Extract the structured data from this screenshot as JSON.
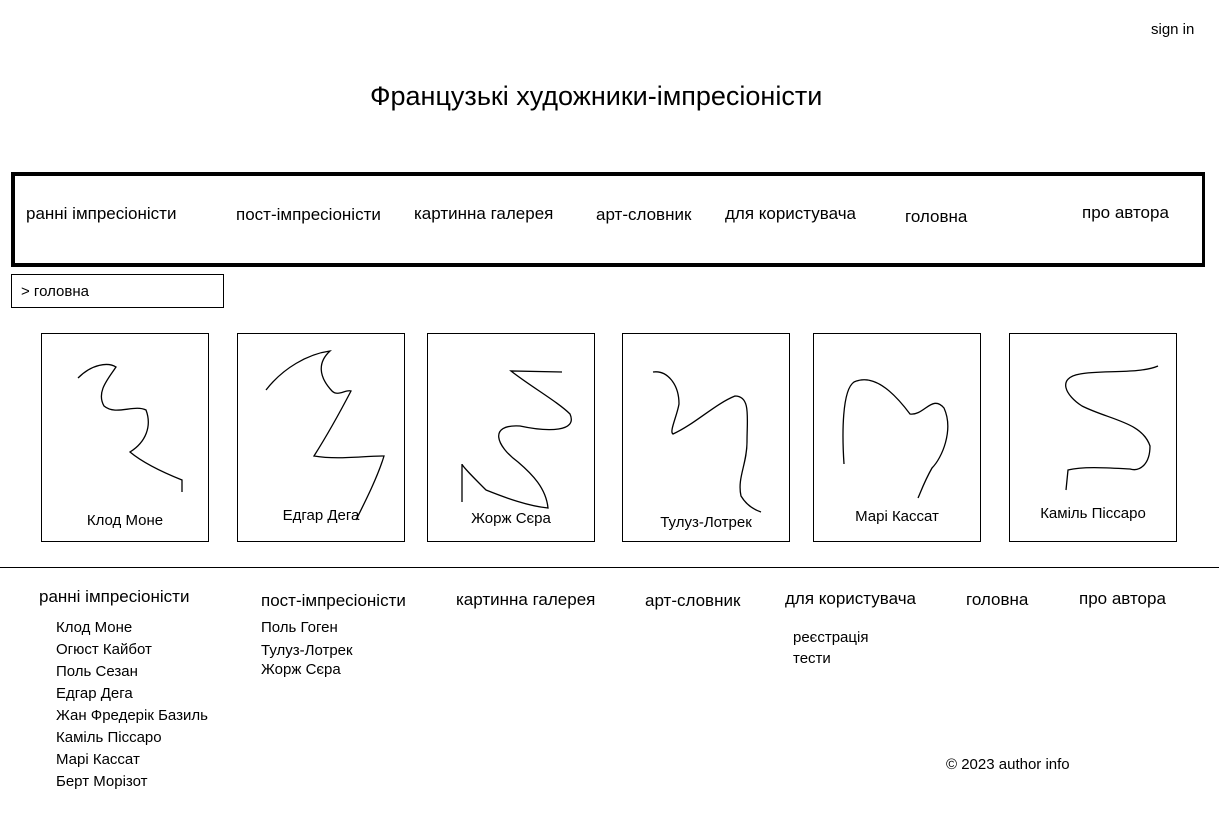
{
  "header": {
    "sign_in": "sign in",
    "title": "Французькі художники-імпресіоністи"
  },
  "nav": {
    "items": [
      "ранні імпресіоністи",
      "пост-імпресіоністи",
      "картинна галерея",
      "арт-словник",
      "для користувача",
      "головна",
      "про автора"
    ]
  },
  "breadcrumb": "> головна",
  "cards": [
    {
      "caption": "Клод Моне"
    },
    {
      "caption": "Едгар Дега"
    },
    {
      "caption": "Жорж Сєра"
    },
    {
      "caption": "Тулуз-Лотрек"
    },
    {
      "caption": "Марі Кассат"
    },
    {
      "caption": "Каміль Піссаро"
    }
  ],
  "footer": {
    "headings": [
      "ранні імпресіоністи",
      "пост-імпресіоністи",
      "картинна галерея",
      "арт-словник",
      "для користувача",
      "головна",
      "про автора"
    ],
    "early": [
      "Клод Моне",
      "Огюст Кайбот",
      "Поль Сезан",
      "Едгар Дега",
      "Жан Фредерік Базиль",
      "Каміль Піссаро",
      "Марі Кассат",
      "Берт Морізот"
    ],
    "post": [
      "Поль Гоген",
      "Тулуз-Лотрек",
      "Жорж Сєра"
    ],
    "user": [
      "реєстрація",
      "тести"
    ],
    "copyright": "© 2023 author info"
  }
}
